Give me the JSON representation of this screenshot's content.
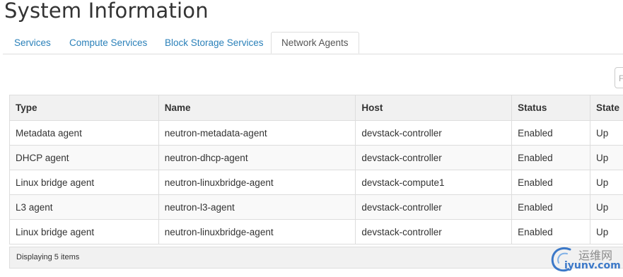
{
  "page": {
    "title": "System Information"
  },
  "tabs": [
    {
      "label": "Services"
    },
    {
      "label": "Compute Services"
    },
    {
      "label": "Block Storage Services"
    },
    {
      "label": "Network Agents",
      "active": true
    }
  ],
  "filter": {
    "placeholder": "F"
  },
  "table": {
    "columns": [
      "Type",
      "Name",
      "Host",
      "Status",
      "State"
    ],
    "rows": [
      [
        "Metadata agent",
        "neutron-metadata-agent",
        "devstack-controller",
        "Enabled",
        "Up"
      ],
      [
        "DHCP agent",
        "neutron-dhcp-agent",
        "devstack-controller",
        "Enabled",
        "Up"
      ],
      [
        "Linux bridge agent",
        "neutron-linuxbridge-agent",
        "devstack-compute1",
        "Enabled",
        "Up"
      ],
      [
        "L3 agent",
        "neutron-l3-agent",
        "devstack-controller",
        "Enabled",
        "Up"
      ],
      [
        "Linux bridge agent",
        "neutron-linuxbridge-agent",
        "devstack-controller",
        "Enabled",
        "Up"
      ]
    ],
    "footer": "Displaying 5 items"
  },
  "watermark": {
    "cn": "运维网",
    "en": "iyunv.com"
  },
  "colors": {
    "link": "#2a80b9",
    "header_bg": "#f1f1f1",
    "border": "#dddddd"
  }
}
